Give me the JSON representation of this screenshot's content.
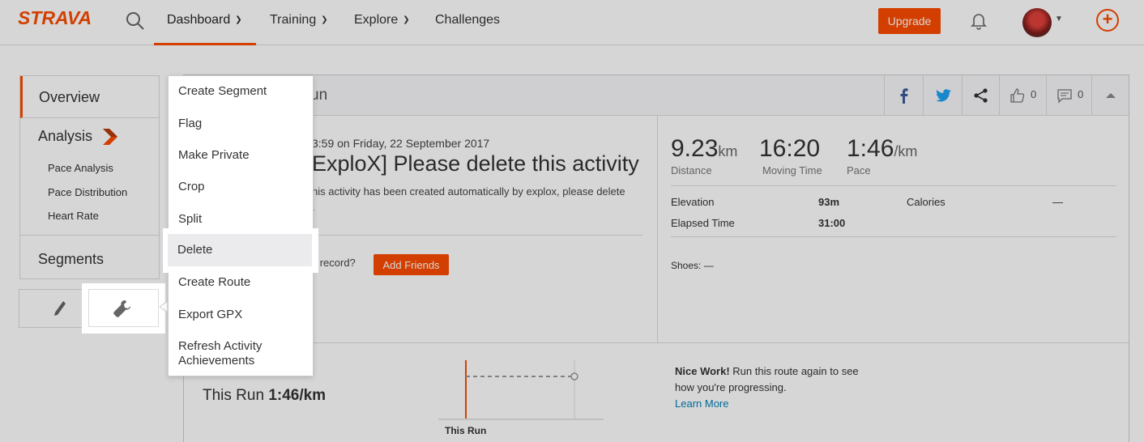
{
  "header": {
    "logo": "STRAVA",
    "nav": [
      {
        "label": "Dashboard",
        "active": true,
        "dropdown": true
      },
      {
        "label": "Training",
        "dropdown": true
      },
      {
        "label": "Explore",
        "dropdown": true
      },
      {
        "label": "Challenges",
        "dropdown": false
      }
    ],
    "upgrade_label": "Upgrade",
    "icons": {
      "search": "search-icon",
      "notifications": "bell-icon",
      "create": "plus-icon"
    },
    "accent": "#fc4c02"
  },
  "sidebar": {
    "overview": "Overview",
    "analysis": "Analysis",
    "analysis_items": [
      "Pace Analysis",
      "Pace Distribution",
      "Heart Rate"
    ],
    "segments": "Segments",
    "tools": {
      "edit": "pencil-icon",
      "actions": "wrench-icon"
    }
  },
  "activity": {
    "title_fragment": "un",
    "date_fragment": "3:59 on Friday, 22 September 2017",
    "name_fragment": "ExploX] Please delete this activity",
    "description_line1": "his activity has been created automatically by explox, please delete",
    "description_line2": ".",
    "friends_question_fragment": "'t record?",
    "add_friends_label": "Add Friends",
    "kudos_count": "0",
    "comments_count": "0"
  },
  "stats": {
    "distance": {
      "value": "9.23",
      "unit": "km",
      "label": "Distance"
    },
    "moving_time": {
      "value": "16:20",
      "label": "Moving Time"
    },
    "pace": {
      "value": "1:46",
      "unit": "/km",
      "label": "Pace"
    },
    "elevation": {
      "label": "Elevation",
      "value": "93m"
    },
    "elapsed": {
      "label": "Elapsed Time",
      "value": "31:00"
    },
    "calories": {
      "label": "Calories",
      "value": "—"
    },
    "shoes": "Shoes: —"
  },
  "comparison": {
    "this_run_prefix": "This Run",
    "this_run_pace": "1:46/km",
    "chart_label": "This Run",
    "nice_work_bold": "Nice Work!",
    "nice_work_text": " Run this route again to see how you're progressing.",
    "learn_more": "Learn More"
  },
  "actions_menu": {
    "items": [
      "Create Segment",
      "Flag",
      "Make Private",
      "Crop",
      "Split",
      "Delete",
      "Create Route",
      "Export GPX",
      "Refresh Activity Achievements"
    ],
    "highlighted": "Delete"
  }
}
